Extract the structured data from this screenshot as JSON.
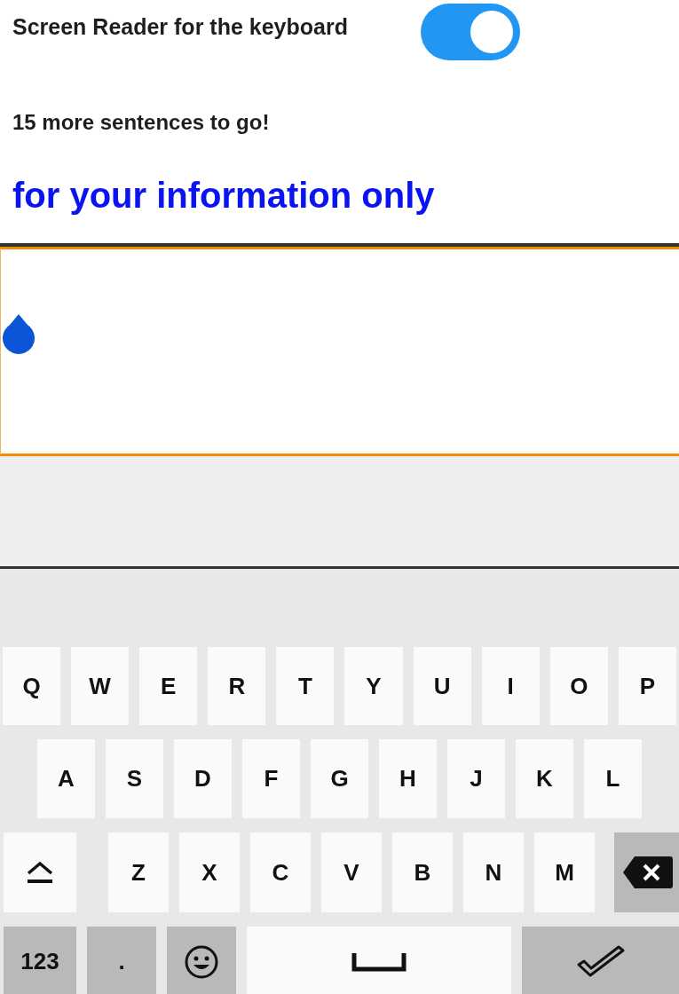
{
  "setting": {
    "label": "Screen Reader for the keyboard",
    "on": true
  },
  "progress_text": "15 more sentences to go!",
  "prompt": "for your information only",
  "keyboard": {
    "rows": [
      [
        {
          "kind": "letter",
          "label": "Q"
        },
        {
          "kind": "letter",
          "label": "W"
        },
        {
          "kind": "letter",
          "label": "E"
        },
        {
          "kind": "letter",
          "label": "R"
        },
        {
          "kind": "letter",
          "label": "T"
        },
        {
          "kind": "letter",
          "label": "Y"
        },
        {
          "kind": "letter",
          "label": "U"
        },
        {
          "kind": "letter",
          "label": "I"
        },
        {
          "kind": "letter",
          "label": "O"
        },
        {
          "kind": "letter",
          "label": "P"
        }
      ],
      [
        {
          "kind": "letter",
          "label": "A"
        },
        {
          "kind": "letter",
          "label": "S"
        },
        {
          "kind": "letter",
          "label": "D"
        },
        {
          "kind": "letter",
          "label": "F"
        },
        {
          "kind": "letter",
          "label": "G"
        },
        {
          "kind": "letter",
          "label": "H"
        },
        {
          "kind": "letter",
          "label": "J"
        },
        {
          "kind": "letter",
          "label": "K"
        },
        {
          "kind": "letter",
          "label": "L"
        }
      ],
      [
        {
          "kind": "shift"
        },
        {
          "kind": "letter",
          "label": "Z"
        },
        {
          "kind": "letter",
          "label": "X"
        },
        {
          "kind": "letter",
          "label": "C"
        },
        {
          "kind": "letter",
          "label": "V"
        },
        {
          "kind": "letter",
          "label": "B"
        },
        {
          "kind": "letter",
          "label": "N"
        },
        {
          "kind": "letter",
          "label": "M"
        },
        {
          "kind": "backspace"
        }
      ],
      [
        {
          "kind": "symbols",
          "label": "123"
        },
        {
          "kind": "period",
          "label": "."
        },
        {
          "kind": "emoji"
        },
        {
          "kind": "space"
        },
        {
          "kind": "enter"
        }
      ]
    ]
  }
}
